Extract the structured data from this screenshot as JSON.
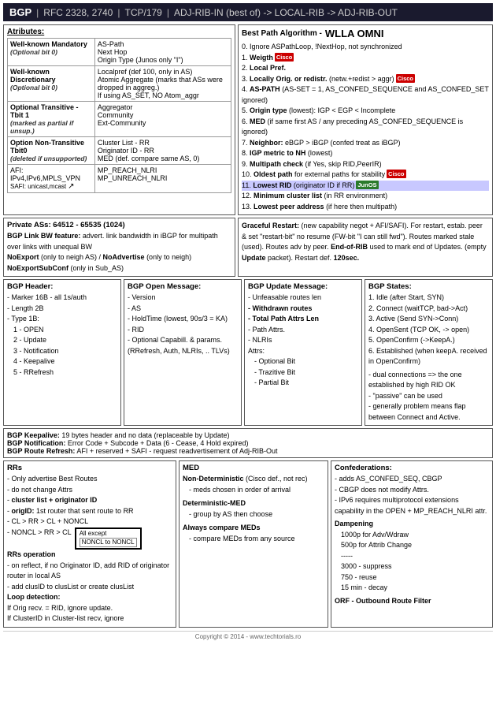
{
  "header": {
    "title": "BGP",
    "sep1": "|",
    "rfc": "RFC 2328, 2740",
    "sep2": "|",
    "protocol": "TCP/179",
    "sep3": "|",
    "path": "ADJ-RIB-IN (best of) -> LOCAL-RIB -> ADJ-RIB-OUT"
  },
  "attributes": {
    "title": "Atributes:",
    "rows": [
      {
        "category": "Well-known Mandatory",
        "sub": "(Optional bit 0)",
        "attrs": [
          "AS-Path",
          "Next Hop",
          "Origin Type (Junos only \"I\")"
        ]
      },
      {
        "category": "Well-known Discretionary",
        "sub": "(Optional bit 0)",
        "attrs": [
          "Localpref (def 100, only in AS)",
          "Atomic Aggregate (marks that ASs were dropped in aggreg.)\nIf using AS_SET, NO Atom_aggr"
        ]
      },
      {
        "category": "Optional Transitive - Tbit 1",
        "sub": "(marked as partial if unsup.)",
        "attrs": [
          "Aggregator",
          "Community",
          "Ext-Community"
        ]
      },
      {
        "category": "Option Non-Transitive Tbit0",
        "sub": "(deleted if unsupported)",
        "attrs": [
          "Cluster List - RR",
          "Originator ID - RR",
          "MED (def. compare same AS, 0)"
        ]
      },
      {
        "category": "AFI: IPv4,IPv6,MPLS_VPN",
        "sub": "",
        "attrs": [
          "MP_REACH_NLRI"
        ]
      },
      {
        "category": "SAFI: unicast,mcast",
        "sub": "",
        "attrs": [
          "MP_UNREACH_NLRI"
        ]
      }
    ]
  },
  "bestpath": {
    "title": "Best Path Algorithm -",
    "algo": "WLLA OMNI",
    "items": [
      {
        "num": "0.",
        "text": "Ignore ASPathLoop, !NextHop, not synchronized"
      },
      {
        "num": "1.",
        "text": "Weigth",
        "badge": "Cisco",
        "badgeType": "cisco"
      },
      {
        "num": "2.",
        "text": "Local Pref."
      },
      {
        "num": "3.",
        "text": "Locally Orig. or redistr. (netw.+redist > aggr)",
        "badge": "Cisco",
        "badgeType": "cisco"
      },
      {
        "num": "4.",
        "text": "AS-PATH (AS-SET = 1, AS_CONFED_SEQUENCE and AS_CONFED_SET ignored)"
      },
      {
        "num": "5.",
        "text": "Origin type (lowest): IGP < EGP < Incomplete"
      },
      {
        "num": "6.",
        "text": "MED (if same first AS / any preceding AS_CONFED_SEQUENCE is ignored)"
      },
      {
        "num": "7.",
        "text": "Neighbor: eBGP > iBGP (confed treat as iBGP)"
      },
      {
        "num": "8.",
        "text": "IGP metric to NH (lowest)"
      },
      {
        "num": "9.",
        "text": "Multipath check (if Yes, skip RID,PeerIR)"
      },
      {
        "num": "10.",
        "text": "Oldest path for external paths for stability",
        "badge": "Cisco",
        "badgeType": "cisco"
      },
      {
        "num": "11.",
        "text": "Lowest RID (originator ID if RR)",
        "badge": "JunOS",
        "badgeType": "junos"
      },
      {
        "num": "12.",
        "text": "Minimum cluster list (in RR environment)"
      },
      {
        "num": "13.",
        "text": "Lowest peer address (if here then multipath)"
      }
    ]
  },
  "private": {
    "title": "Private ASs: 64512 - 65535 (1024)",
    "items": [
      "BGP Link BW feature: advert. link bandwidth in iBGP for multipath over links with unequal BW",
      "NoExport (only to neigh AS) / NoAdvertise (only to neigh)",
      "NoExportSubConf (only in Sub_AS)"
    ]
  },
  "graceful": {
    "title": "Graceful Restart:",
    "text": "(new capability negot + AFI/SAFI). For restart, estab. peer & set \"restart-bit\" no resume (FW-bit \"I can still fwd\"). Routes marked stale (used). Routes adv by peer. End-of-RIB used to mark end of Updates. (empty Update packet). Restart def. 120sec."
  },
  "bgpHeader": {
    "title": "BGP Header:",
    "items": [
      "Marker 16B - all 1s/auth",
      "Length 2B",
      "Type 1B:",
      "  1 - OPEN",
      "  2 - Update",
      "  3 - Notification",
      "  4 - Keepalive",
      "  5 - RRefresh"
    ]
  },
  "bgpOpen": {
    "title": "BGP Open Message:",
    "items": [
      "Version",
      "AS",
      "HoldTime (lowest, 90s/3 = KA)",
      "RID",
      "Optional Capabill. & params.",
      "(RRefresh, Auth, NLRIs, .. TLVs)"
    ]
  },
  "bgpUpdate": {
    "title": "BGP Update Message:",
    "items": [
      "Unfeasable routes len",
      "Withdrawn routes",
      "Total Path Attrs Len",
      "Path Attrs.",
      "NLRIs",
      "Attrs:",
      "  Optional Bit",
      "  Trazitive Bit",
      "  Partial Bit"
    ]
  },
  "bgpStates": {
    "title": "BGP States:",
    "items": [
      "1. Idle (after Start, SYN)",
      "2. Connect (waitTCP, bad->Act)",
      "3. Active (Send SYN->Conn)",
      "4. OpenSent (TCP OK, -> open)",
      "5. OpenConfirm (->KeepA.)",
      "6. Established (when keepA. received in OpenConfirm)",
      "",
      "- dual connections => the one established by high RID OK",
      "- \"passive\" can be used",
      "- generally problem means flap between Connect and Active."
    ]
  },
  "keepalive": {
    "text1": "BGP Keepalive: 19 bytes header and no data (replaceable by Update)",
    "text2": "BGP Notification: Error Code + Subcode + Data (6 - Cease, 4 Hold expired)",
    "text3": "BGP Route Refresh: AFI + reserved + SAFI - request readvertisement of Adj-RIB-Out"
  },
  "rr": {
    "title": "RRs",
    "items": [
      "Only advertise Best Routes",
      "do not change Attrs",
      "cluster list + originator ID",
      "origID: 1st router that sent route to RR",
      "CL > RR > CL + NONCL",
      "NONCL > RR > CL",
      "RRs operation",
      "on reflect, if no Originator ID, add RID of originator router in local AS",
      "add clusID to clusList or create clusList",
      "Loop detection:",
      "If Orig recv. = RID, ignore update.",
      "If ClusterID in Cluster-list recv, ignore"
    ],
    "allexcept": "All except",
    "noncl": "NONCL to NONCL"
  },
  "med": {
    "title": "MED",
    "nondeterministic": "Non-Deterministic (Cisco def., not rec)",
    "nd_sub": "meds chosen in order of arrival",
    "deterministic": "Deterministic-MED",
    "det_sub": "group by AS then choose",
    "always": "Always compare MEDs",
    "always_sub": "compare MEDs from any source"
  },
  "confed": {
    "title": "Confederations:",
    "items": [
      "adds AS_CONFED_SEQ, CBGP",
      "CBGP does not modify Attrs.",
      "IPv6 requires multiprotocol extensions capability in the OPEN + MP_REACH_NLRI attr.",
      "Dampening",
      "  1000p for Adv/Wdraw",
      "  500p for Attrib Change",
      "  -----",
      "  3000 - suppress",
      "  750 - reuse",
      "  15 min - decay",
      "ORF - Outbound Route Filter"
    ]
  },
  "footer": {
    "text": "Copyright © 2014 - www.techtorials.ro"
  }
}
